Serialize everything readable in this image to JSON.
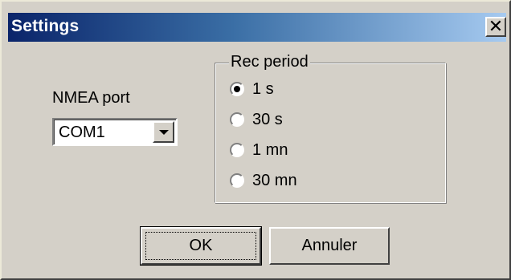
{
  "window": {
    "title": "Settings",
    "close_glyph": "✕"
  },
  "nmea": {
    "label": "NMEA port",
    "selected": "COM1"
  },
  "rec_period": {
    "legend": "Rec period",
    "options": [
      {
        "label": "1 s",
        "checked": true
      },
      {
        "label": "30 s",
        "checked": false
      },
      {
        "label": "1 mn",
        "checked": false
      },
      {
        "label": "30 mn",
        "checked": false
      }
    ]
  },
  "buttons": {
    "ok": "OK",
    "cancel": "Annuler"
  },
  "colors": {
    "title_gradient_start": "#0a246a",
    "title_gradient_end": "#a6caf0",
    "face": "#d4d0c8"
  }
}
